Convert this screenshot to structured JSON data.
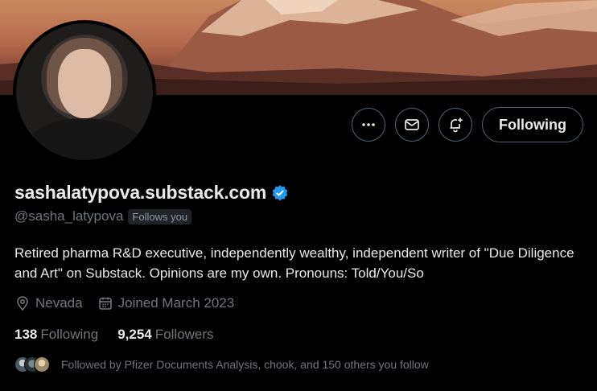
{
  "banner": {
    "description_icon": "mountain-banner",
    "colors": {
      "sky": "#c9895f",
      "snow": "#e7c3a8",
      "slope": "#8a4a38"
    }
  },
  "profile": {
    "display_name": "sashalatypova.substack.com",
    "verified_icon": "verified-badge-icon",
    "handle": "@sasha_latypova",
    "follows_you_badge": "Follows you",
    "bio": "Retired pharma R&D executive, independently wealthy, independent writer of \"Due Diligence and Art\" on Substack.  Opinions are my own. Pronouns: Told/You/So",
    "location": "Nevada",
    "joined": "Joined March 2023"
  },
  "actions": {
    "more_icon": "more-icon",
    "message_icon": "mail-icon",
    "notify_icon": "bell-plus-icon",
    "follow_label": "Following"
  },
  "stats": {
    "following_count": "138",
    "following_label": "Following",
    "followers_count": "9,254",
    "followers_label": "Followers"
  },
  "followed_by": {
    "text": "Followed by Pfizer Documents Analysis, chook, and 150 others you follow"
  },
  "colors": {
    "accent_verified": "#1d9bf0",
    "text_primary": "#e7e9ea",
    "text_secondary": "#71767b",
    "border": "#536471"
  }
}
